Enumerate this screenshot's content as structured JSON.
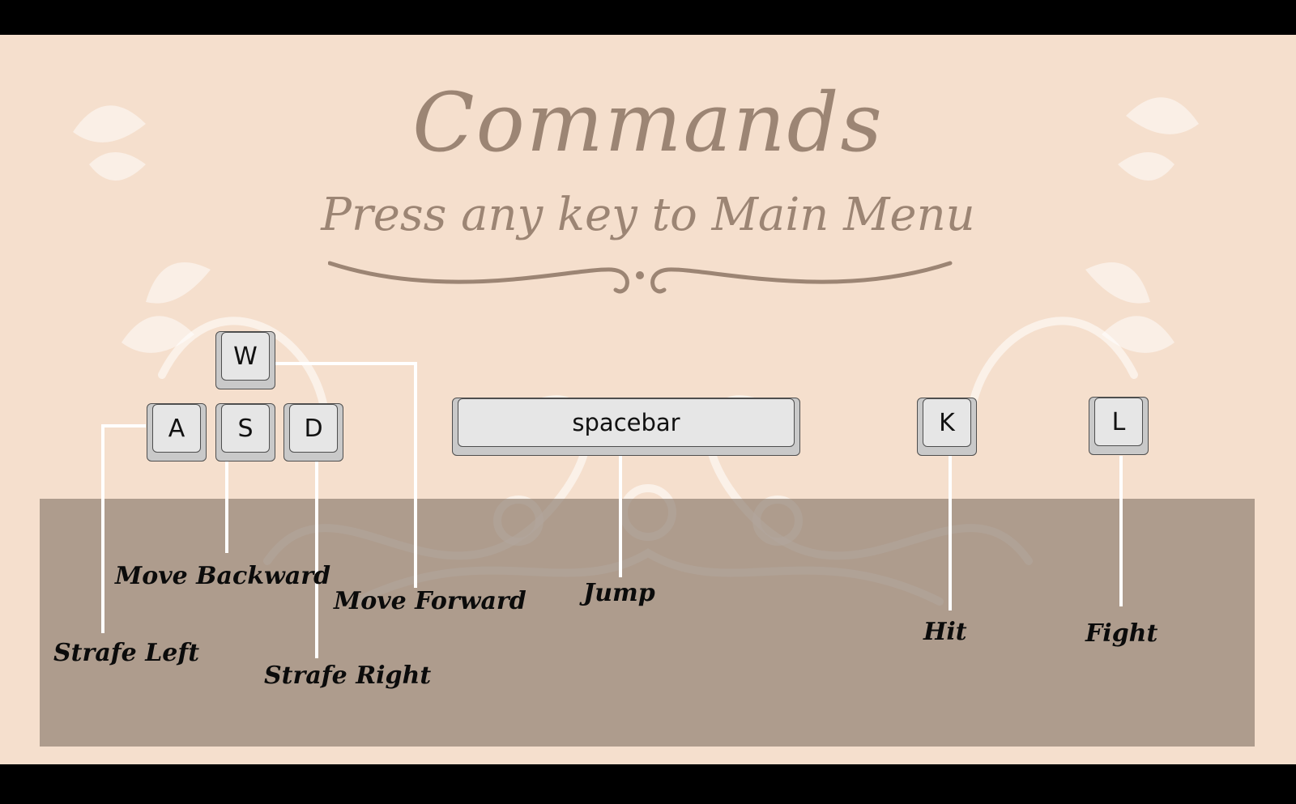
{
  "screen": {
    "title": "Commands",
    "subtitle": "Press any key to Main Menu"
  },
  "keys": {
    "w": "W",
    "a": "A",
    "s": "S",
    "d": "D",
    "space": "spacebar",
    "k": "K",
    "l": "L"
  },
  "labels": {
    "move_backward": "Move Backward",
    "move_forward": "Move Forward",
    "strafe_left": "Strafe Left",
    "strafe_right": "Strafe Right",
    "jump": "Jump",
    "hit": "Hit",
    "fight": "Fight"
  },
  "colors": {
    "background": "#f5dfcd",
    "title": "#9c8574",
    "panel": "#a99a8c",
    "connector": "#ffffff"
  }
}
